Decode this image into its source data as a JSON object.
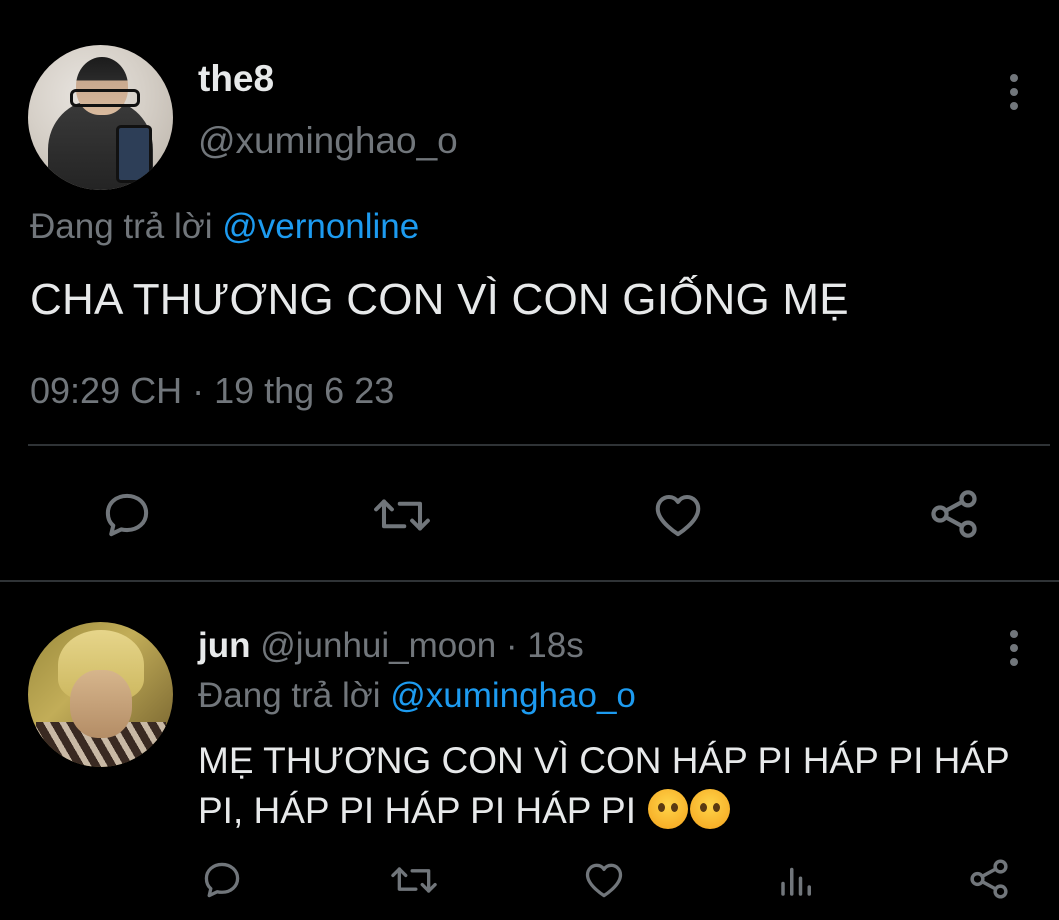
{
  "main_tweet": {
    "display_name": "the8",
    "handle": "@xuminghao_o",
    "reply_prefix": "Đang trả lời ",
    "reply_mention": "@vernonline",
    "text": "CHA THƯƠNG CON VÌ CON GIỐNG MẸ",
    "timestamp": "09:29 CH · 19 thg 6 23"
  },
  "reply_tweet": {
    "display_name": "jun",
    "handle": "@junhui_moon",
    "age": "· 18s",
    "reply_prefix": "Đang trả lời ",
    "reply_mention": "@xuminghao_o",
    "text": "MẸ THƯƠNG CON VÌ CON HÁP PI HÁP PI HÁP PI, HÁP PI HÁP PI HÁP PI",
    "emojis": [
      "pleading-face",
      "pleading-face"
    ]
  },
  "icons": {
    "reply": "reply-icon",
    "retweet": "retweet-icon",
    "like": "heart-icon",
    "share": "share-icon",
    "views": "views-icon",
    "more": "more-vertical-icon"
  },
  "colors": {
    "background": "#000000",
    "primary_text": "#e7e9ea",
    "secondary_text": "#71767b",
    "link": "#1d9bf0",
    "divider": "#2f3336"
  }
}
